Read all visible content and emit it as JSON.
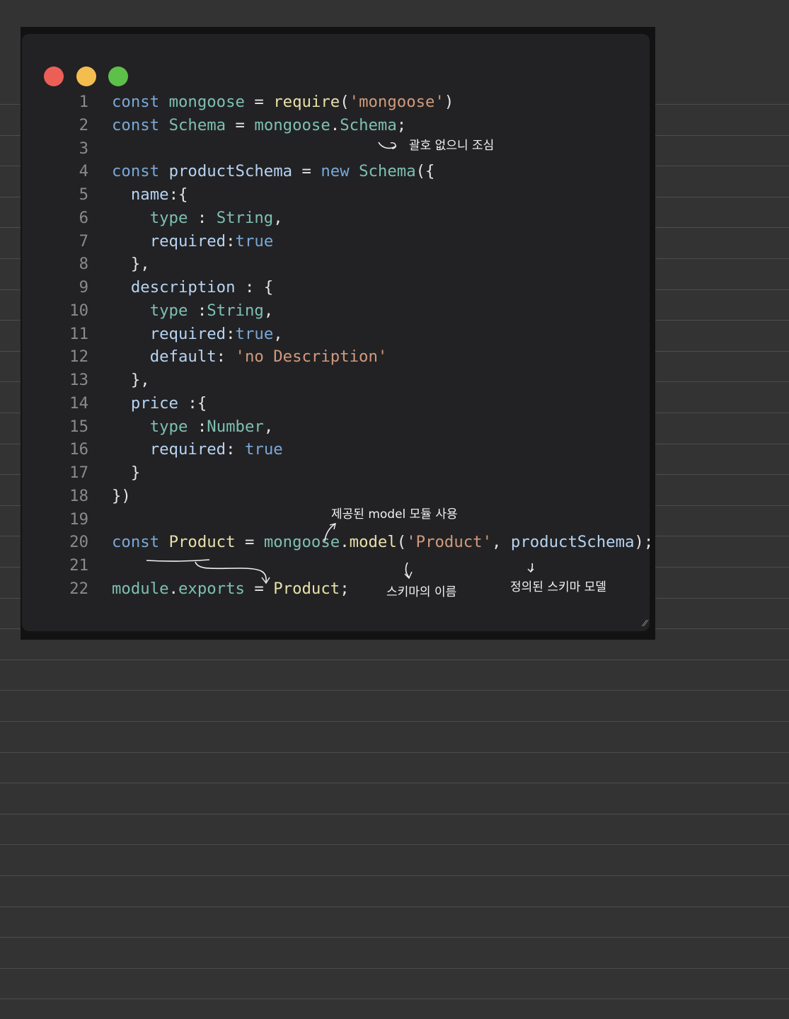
{
  "window": {
    "buttons": [
      {
        "name": "close",
        "color": "#ec5f57"
      },
      {
        "name": "minimize",
        "color": "#f4be4f"
      },
      {
        "name": "maximize",
        "color": "#5dc048"
      }
    ]
  },
  "code": {
    "lines": [
      {
        "n": "1",
        "tokens": [
          [
            "kw",
            "const"
          ],
          [
            "pun",
            " "
          ],
          [
            "var",
            "mongoose"
          ],
          [
            "pun",
            " = "
          ],
          [
            "fn",
            "require"
          ],
          [
            "pun",
            "("
          ],
          [
            "str",
            "'mongoose'"
          ],
          [
            "pun",
            ")"
          ]
        ]
      },
      {
        "n": "2",
        "tokens": [
          [
            "kw",
            "const"
          ],
          [
            "pun",
            " "
          ],
          [
            "var",
            "Schema"
          ],
          [
            "pun",
            " = "
          ],
          [
            "var",
            "mongoose"
          ],
          [
            "pun",
            "."
          ],
          [
            "var",
            "Schema"
          ],
          [
            "pun",
            ";"
          ]
        ]
      },
      {
        "n": "3",
        "tokens": []
      },
      {
        "n": "4",
        "tokens": [
          [
            "kw",
            "const"
          ],
          [
            "pun",
            " "
          ],
          [
            "prop",
            "productSchema"
          ],
          [
            "pun",
            " = "
          ],
          [
            "kw",
            "new"
          ],
          [
            "pun",
            " "
          ],
          [
            "var",
            "Schema"
          ],
          [
            "pun",
            "({"
          ]
        ]
      },
      {
        "n": "5",
        "tokens": [
          [
            "pun",
            "  "
          ],
          [
            "prop",
            "name"
          ],
          [
            "pun",
            ":{"
          ]
        ]
      },
      {
        "n": "6",
        "tokens": [
          [
            "pun",
            "    "
          ],
          [
            "typ",
            "type"
          ],
          [
            "pun",
            " : "
          ],
          [
            "typ",
            "String"
          ],
          [
            "pun",
            ","
          ]
        ]
      },
      {
        "n": "7",
        "tokens": [
          [
            "pun",
            "    "
          ],
          [
            "prop",
            "required"
          ],
          [
            "pun",
            ":"
          ],
          [
            "bool",
            "true"
          ]
        ]
      },
      {
        "n": "8",
        "tokens": [
          [
            "pun",
            "  },"
          ]
        ]
      },
      {
        "n": "9",
        "tokens": [
          [
            "pun",
            "  "
          ],
          [
            "prop",
            "description"
          ],
          [
            "pun",
            " : {"
          ]
        ]
      },
      {
        "n": "10",
        "tokens": [
          [
            "pun",
            "    "
          ],
          [
            "typ",
            "type"
          ],
          [
            "pun",
            " :"
          ],
          [
            "typ",
            "String"
          ],
          [
            "pun",
            ","
          ]
        ]
      },
      {
        "n": "11",
        "tokens": [
          [
            "pun",
            "    "
          ],
          [
            "prop",
            "required"
          ],
          [
            "pun",
            ":"
          ],
          [
            "bool",
            "true"
          ],
          [
            "pun",
            ","
          ]
        ]
      },
      {
        "n": "12",
        "tokens": [
          [
            "pun",
            "    "
          ],
          [
            "prop",
            "default"
          ],
          [
            "pun",
            ": "
          ],
          [
            "str",
            "'no Description'"
          ]
        ]
      },
      {
        "n": "13",
        "tokens": [
          [
            "pun",
            "  },"
          ]
        ]
      },
      {
        "n": "14",
        "tokens": [
          [
            "pun",
            "  "
          ],
          [
            "prop",
            "price"
          ],
          [
            "pun",
            " :{"
          ]
        ]
      },
      {
        "n": "15",
        "tokens": [
          [
            "pun",
            "    "
          ],
          [
            "typ",
            "type"
          ],
          [
            "pun",
            " :"
          ],
          [
            "typ",
            "Number"
          ],
          [
            "pun",
            ","
          ]
        ]
      },
      {
        "n": "16",
        "tokens": [
          [
            "pun",
            "    "
          ],
          [
            "prop",
            "required"
          ],
          [
            "pun",
            ": "
          ],
          [
            "bool",
            "true"
          ]
        ]
      },
      {
        "n": "17",
        "tokens": [
          [
            "pun",
            "  }"
          ]
        ]
      },
      {
        "n": "18",
        "tokens": [
          [
            "pun",
            "})"
          ]
        ]
      },
      {
        "n": "19",
        "tokens": []
      },
      {
        "n": "20",
        "tokens": [
          [
            "kw",
            "const"
          ],
          [
            "pun",
            " "
          ],
          [
            "fn",
            "Product"
          ],
          [
            "pun",
            " = "
          ],
          [
            "var",
            "mongoose"
          ],
          [
            "pun",
            "."
          ],
          [
            "fn",
            "model"
          ],
          [
            "pun",
            "("
          ],
          [
            "str",
            "'Product'"
          ],
          [
            "pun",
            ", "
          ],
          [
            "prop",
            "productSchema"
          ],
          [
            "pun",
            ");"
          ]
        ]
      },
      {
        "n": "21",
        "tokens": []
      },
      {
        "n": "22",
        "tokens": [
          [
            "var",
            "module"
          ],
          [
            "pun",
            "."
          ],
          [
            "var",
            "exports"
          ],
          [
            "pun",
            " = "
          ],
          [
            "fn",
            "Product"
          ],
          [
            "pun",
            ";"
          ]
        ]
      }
    ]
  },
  "annotations": {
    "brackets_note": "괄호 없으니 조심",
    "model_note": "제공된 model 모듈 사용",
    "schema_name_note": "스키마의 이름",
    "schema_model_note": "정의된 스키마 모델"
  }
}
